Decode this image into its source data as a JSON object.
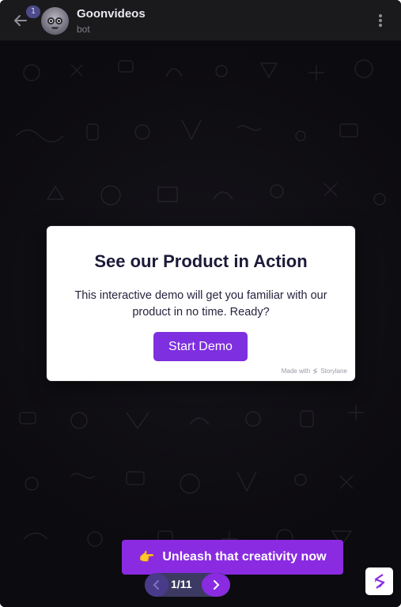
{
  "header": {
    "unread_count": "1",
    "title": "Goonvideos",
    "subtitle": "bot"
  },
  "modal": {
    "title": "See our Product in Action",
    "text": "This interactive demo will get you familiar with our product in no time. Ready?",
    "start_label": "Start Demo",
    "made_with_prefix": "Made with",
    "made_with_brand": "Storylane"
  },
  "cta": {
    "hand_glyph": "👉",
    "label": "Unleash that creativity now"
  },
  "pager": {
    "current": "1",
    "total": "11",
    "text": "1/11"
  },
  "colors": {
    "accent": "#8a2be2",
    "start_button": "#7e2fe0",
    "header_bg": "#1a1a1d",
    "chat_bg": "#0c0b0f"
  },
  "icons": {
    "back": "arrow-left-icon",
    "menu": "kebab-menu-icon",
    "prev": "chevron-left-icon",
    "next": "chevron-right-icon",
    "logo": "storylane-logo-icon"
  }
}
